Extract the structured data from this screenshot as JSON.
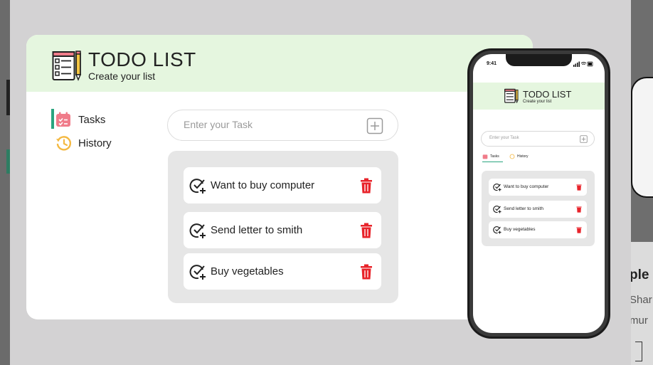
{
  "app": {
    "title": "TODO LIST",
    "subtitle": "Create your list"
  },
  "sidebar": {
    "items": [
      {
        "label": "Tasks",
        "icon": "calendar-check-icon",
        "active": true
      },
      {
        "label": "History",
        "icon": "history-icon",
        "active": false
      }
    ]
  },
  "task_input": {
    "placeholder": "Enter your Task",
    "add_icon": "plus-square-icon"
  },
  "tasks": [
    {
      "text": "Want to buy computer"
    },
    {
      "text": "Send letter to smith"
    },
    {
      "text": "Buy vegetables"
    }
  ],
  "phone": {
    "time": "9:41",
    "title": "TODO LIST",
    "subtitle": "Create your list",
    "input_placeholder": "Enter your Task",
    "tabs": [
      "Tasks",
      "History"
    ],
    "tasks": [
      "Want to buy computer",
      "Send letter to smith",
      "Buy vegetables"
    ]
  },
  "background_page": {
    "heading_fragment": "ple",
    "text_fragment_1": "Shar",
    "text_fragment_2": "mur"
  },
  "colors": {
    "header_bg": "#e5f6df",
    "accent": "#2aa57f",
    "delete": "#e8232a",
    "list_bg": "#e6e6e6",
    "overlay": "#d3d2d3"
  }
}
